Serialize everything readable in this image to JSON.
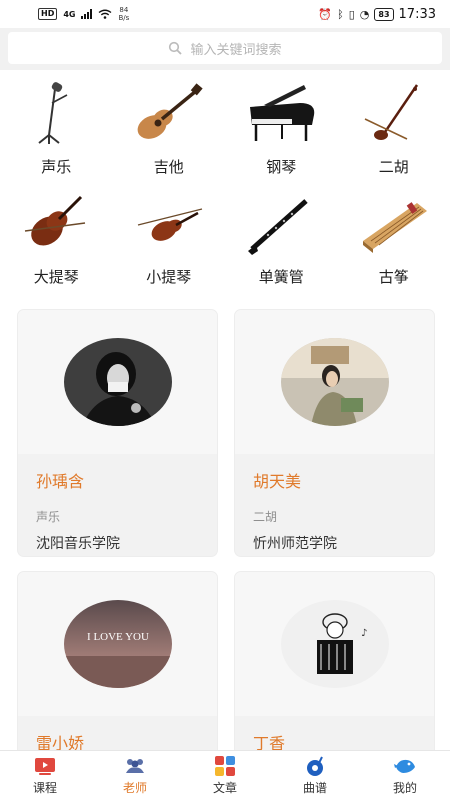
{
  "status_bar": {
    "hd": "HD",
    "network": "4G",
    "speed_value": "84",
    "speed_unit": "B/s",
    "battery": "83",
    "time": "17:33"
  },
  "search": {
    "placeholder": "输入关键词搜索"
  },
  "categories": [
    {
      "label": "声乐",
      "icon": "microphone-stand-icon"
    },
    {
      "label": "吉他",
      "icon": "guitar-icon"
    },
    {
      "label": "钢琴",
      "icon": "piano-icon"
    },
    {
      "label": "二胡",
      "icon": "erhu-icon"
    },
    {
      "label": "大提琴",
      "icon": "cello-icon"
    },
    {
      "label": "小提琴",
      "icon": "violin-icon"
    },
    {
      "label": "单簧管",
      "icon": "clarinet-icon"
    },
    {
      "label": "古筝",
      "icon": "guzheng-icon"
    }
  ],
  "teachers": [
    {
      "name": "孙瑀含",
      "subject": "声乐",
      "school": "沈阳音乐学院"
    },
    {
      "name": "胡天美",
      "subject": "二胡",
      "school": "忻州师范学院"
    },
    {
      "name": "雷小娇",
      "subject": "",
      "school": ""
    },
    {
      "name": "丁香",
      "subject": "",
      "school": ""
    }
  ],
  "avatar_text": {
    "love": "I LOVE YOU"
  },
  "tabs": [
    {
      "label": "课程",
      "icon": "tv-icon"
    },
    {
      "label": "老师",
      "icon": "teachers-icon"
    },
    {
      "label": "文章",
      "icon": "articles-icon"
    },
    {
      "label": "曲谱",
      "icon": "music-note-icon"
    },
    {
      "label": "我的",
      "icon": "bird-icon"
    }
  ],
  "colors": {
    "accent": "#e07a2b",
    "card_bg": "#f2f2f2",
    "search_bg": "#f1f1f1"
  }
}
